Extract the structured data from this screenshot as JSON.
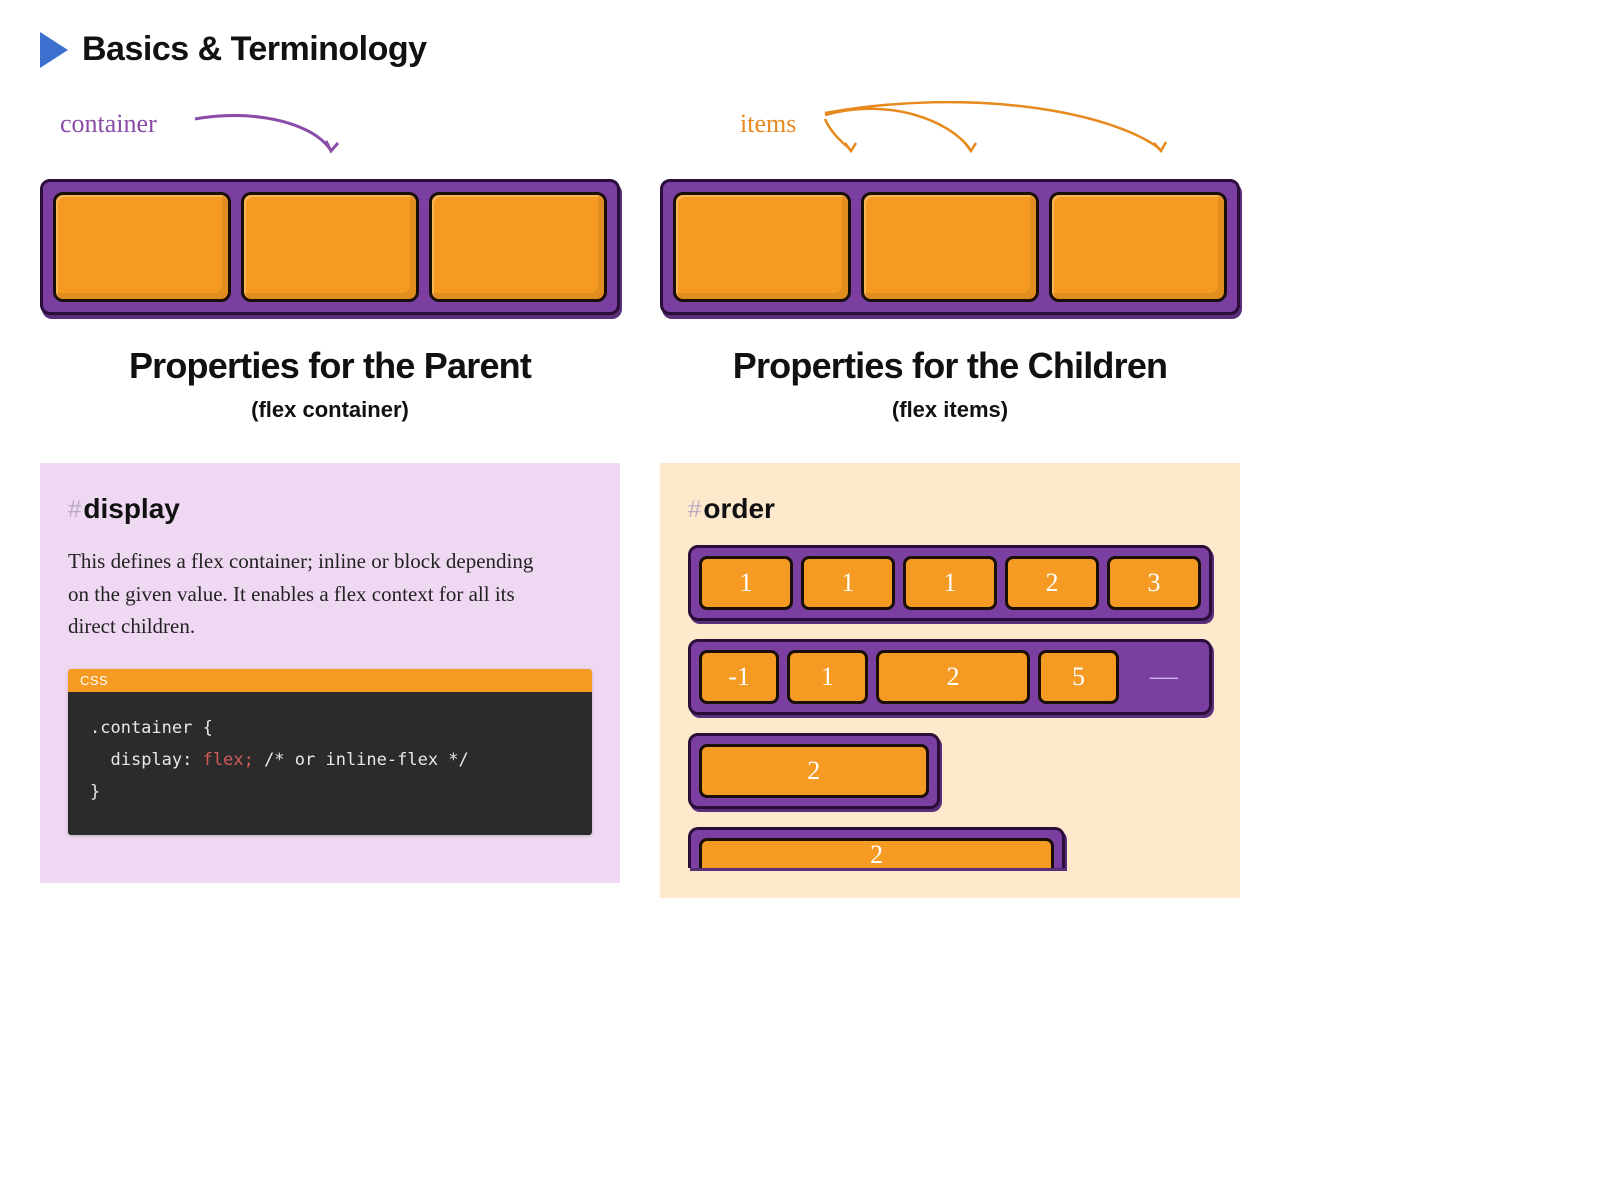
{
  "section_title": "Basics & Terminology",
  "left": {
    "diagram_label": "container",
    "heading": "Properties for the Parent",
    "sub": "(flex container)",
    "prop_title": "display",
    "prop_desc": "This defines a flex container; inline or block depending on the given value. It enables a flex context for all its direct children.",
    "code": {
      "lang": "CSS",
      "selector": ".container {",
      "prop": "display:",
      "value": "flex;",
      "comment": "/* or inline-flex */",
      "close": "}"
    }
  },
  "right": {
    "diagram_label": "items",
    "heading": "Properties for the Children",
    "sub": "(flex items)",
    "prop_title": "order",
    "rows": {
      "r1": [
        "1",
        "1",
        "1",
        "2",
        "3"
      ],
      "r2": [
        "-1",
        "1",
        "2",
        "5"
      ],
      "r3_wide": "2",
      "r4_wide": "2"
    }
  }
}
